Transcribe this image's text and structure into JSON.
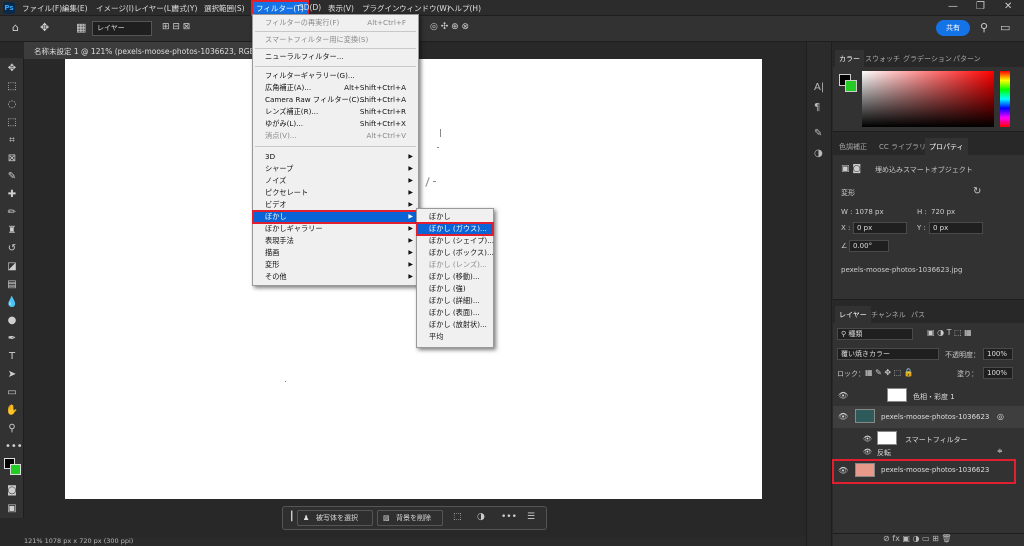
{
  "menubar": {
    "logo": "Ps",
    "items": [
      "ファイル(F)",
      "編集(E)",
      "イメージ(I)",
      "レイヤー(L)",
      "書式(Y)",
      "選択範囲(S)",
      "フィルター(T)",
      "3D(D)",
      "表示(V)",
      "プラグイン",
      "ウィンドウ(W)",
      "ヘルプ(H)"
    ]
  },
  "optbar": {
    "layer_select": "レイヤー",
    "share": "共有"
  },
  "document": {
    "tab_title": "名称未設定 1 @ 121% (pexels-moose-photos-1036623, RGB/8",
    "status": "121%        1078 px x 720 px (300 ppi)"
  },
  "filter_menu": {
    "items": [
      {
        "label": "フィルターの再実行(F)",
        "shortcut": "Alt+Ctrl+F",
        "disabled": true
      },
      {
        "label": "スマートフィルター用に変換(S)",
        "shortcut": "",
        "disabled": true
      },
      {
        "label": "ニューラルフィルター...",
        "shortcut": ""
      },
      {
        "label": "フィルターギャラリー(G)...",
        "shortcut": ""
      },
      {
        "label": "広角補正(A)...",
        "shortcut": "Alt+Shift+Ctrl+A"
      },
      {
        "label": "Camera Raw フィルター(C)...",
        "shortcut": "Shift+Ctrl+A"
      },
      {
        "label": "レンズ補正(R)...",
        "shortcut": "Shift+Ctrl+R"
      },
      {
        "label": "ゆがみ(L)...",
        "shortcut": "Shift+Ctrl+X"
      },
      {
        "label": "消点(V)...",
        "shortcut": "Alt+Ctrl+V",
        "disabled": true
      },
      {
        "label": "3D"
      },
      {
        "label": "シャープ"
      },
      {
        "label": "ノイズ"
      },
      {
        "label": "ピクセレート"
      },
      {
        "label": "ビデオ"
      },
      {
        "label": "ぼかし",
        "highlighted": true
      },
      {
        "label": "ぼかしギャラリー"
      },
      {
        "label": "表現手法"
      },
      {
        "label": "描画"
      },
      {
        "label": "変形"
      },
      {
        "label": "その他"
      }
    ]
  },
  "blur_submenu": {
    "items": [
      "ぼかし",
      "ぼかし (ガウス)...",
      "ぼかし (シェイプ)...",
      "ぼかし (ボックス)...",
      "ぼかし (レンズ)...",
      "ぼかし (移動)...",
      "ぼかし (強)",
      "ぼかし (詳細)...",
      "ぼかし (表面)...",
      "ぼかし (放射状)...",
      "平均"
    ],
    "highlighted_index": 1,
    "disabled_index": 4
  },
  "taskbar": {
    "select_subject": "被写体を選択",
    "remove_bg": "背景を削除",
    "more": "•••"
  },
  "color_panel": {
    "tabs": [
      "カラー",
      "スウォッチ",
      "グラデーション",
      "パターン"
    ],
    "fg": "#000000",
    "bg": "#22cc22"
  },
  "props_panel": {
    "tabs": [
      "色調補正",
      "CC ライブラリ",
      "プロパティ"
    ],
    "object_label": "埋め込みスマートオブジェクト",
    "section": "変形",
    "w_label": "W :",
    "w_value": "1078 px",
    "h_label": "H :",
    "h_value": "720 px",
    "x_label": "X :",
    "x_value": "0 px",
    "y_label": "Y :",
    "y_value": "0 px",
    "angle": "0.00°",
    "filename": "pexels-moose-photos-1036623.jpg"
  },
  "layers_panel": {
    "tabs": [
      "レイヤー",
      "チャンネル",
      "パス"
    ],
    "kind": "種類",
    "blend": "覆い焼きカラー",
    "opacity_label": "不透明度：",
    "opacity": "100%",
    "lock_label": "ロック：",
    "fill_label": "塗り：",
    "fill": "100%",
    "layers": [
      {
        "name": "色相・彩度 1"
      },
      {
        "name": "pexels-moose-photos-1036623"
      },
      {
        "name": "スマートフィルター"
      },
      {
        "name": "反転"
      },
      {
        "name": "pexels-moose-photos-1036623"
      }
    ]
  }
}
